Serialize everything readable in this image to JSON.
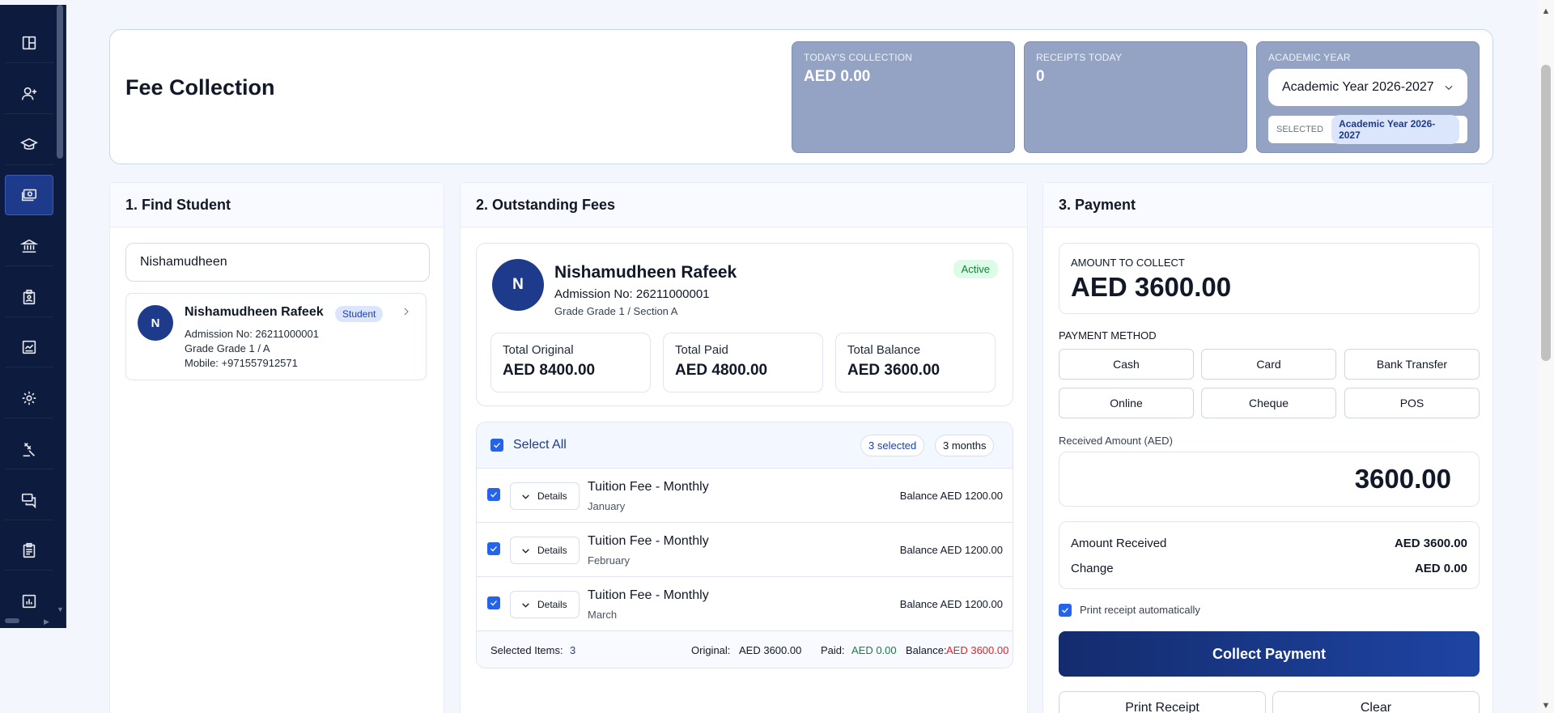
{
  "sidebar": {
    "items": [
      {
        "icon": "dashboard-icon"
      },
      {
        "icon": "add-user-icon"
      },
      {
        "icon": "graduation-cap-icon"
      },
      {
        "icon": "fee-collection-icon",
        "active": true
      },
      {
        "icon": "bank-icon"
      },
      {
        "icon": "id-badge-icon"
      },
      {
        "icon": "report-card-icon"
      },
      {
        "icon": "gear-icon"
      },
      {
        "icon": "gavel-icon"
      },
      {
        "icon": "messages-icon"
      },
      {
        "icon": "clipboard-icon"
      },
      {
        "icon": "chart-icon"
      }
    ]
  },
  "header": {
    "title": "Fee Collection",
    "todays_collection": {
      "label": "TODAY'S COLLECTION",
      "value": "AED 0.00"
    },
    "receipts_today": {
      "label": "RECEIPTS TODAY",
      "value": "0"
    },
    "academic_year": {
      "label": "ACADEMIC YEAR",
      "selected_value": "Academic Year 2026-2027",
      "selected_label": "SELECTED",
      "selected_pill": "Academic Year 2026-2027"
    }
  },
  "find_student": {
    "title": "1. Find Student",
    "search_value": "Nishamudheen",
    "result": {
      "initial": "N",
      "name": "Nishamudheen Rafeek",
      "badge": "Student",
      "admission": "Admission No: 26211000001",
      "grade": "Grade Grade 1 / A",
      "mobile": "Mobile: +971557912571"
    }
  },
  "outstanding": {
    "title": "2. Outstanding Fees",
    "student": {
      "initial": "N",
      "name": "Nishamudheen Rafeek",
      "admission": "Admission No: 26211000001",
      "grade": "Grade Grade 1 / Section A",
      "status": "Active"
    },
    "totals": [
      {
        "label": "Total Original",
        "value": "AED 8400.00"
      },
      {
        "label": "Total Paid",
        "value": "AED 4800.00"
      },
      {
        "label": "Total Balance",
        "value": "AED 3600.00"
      }
    ],
    "select_all": "Select All",
    "selected_pill": "3 selected",
    "months_pill": "3 months",
    "details_label": "Details",
    "rows": [
      {
        "name": "Tuition Fee - Monthly",
        "month": "January",
        "balance": "Balance AED 1200.00"
      },
      {
        "name": "Tuition Fee - Monthly",
        "month": "February",
        "balance": "Balance AED 1200.00"
      },
      {
        "name": "Tuition Fee - Monthly",
        "month": "March",
        "balance": "Balance AED 1200.00"
      }
    ],
    "footer": {
      "selected_label": "Selected Items:",
      "selected_count": "3",
      "original_label": "Original:",
      "original_value": "AED 3600.00",
      "paid_label": "Paid:",
      "paid_value": "AED 0.00",
      "balance_label": "Balance:",
      "balance_value": "AED 3600.00"
    }
  },
  "payment": {
    "title": "3. Payment",
    "amount_label": "AMOUNT TO COLLECT",
    "amount_value": "AED 3600.00",
    "method_label": "PAYMENT METHOD",
    "methods": [
      "Cash",
      "Card",
      "Bank Transfer",
      "Online",
      "Cheque",
      "POS"
    ],
    "received_label": "Received Amount (AED)",
    "received_value": "3600.00",
    "amount_received_label": "Amount Received",
    "amount_received_value": "AED 3600.00",
    "change_label": "Change",
    "change_value": "AED 0.00",
    "auto_print_label": "Print receipt automatically",
    "collect_label": "Collect Payment",
    "print_label": "Print Receipt",
    "clear_label": "Clear"
  },
  "colors": {
    "sidebar_bg": "#0d1b3e",
    "accent": "#1e3a8a",
    "stat_box": "#94a3c4",
    "paid_green": "#15803d",
    "balance_red": "#dc2626"
  }
}
